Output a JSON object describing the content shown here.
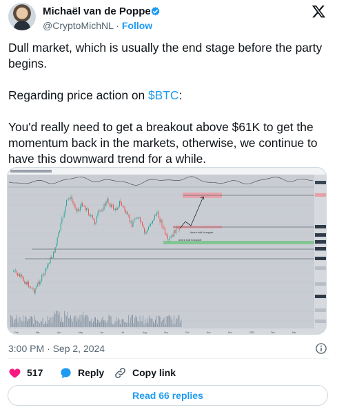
{
  "author": {
    "name": "Michaël van de Poppe",
    "handle": "@CryptoMichNL",
    "separator": " · ",
    "follow_label": "Follow"
  },
  "tweet": {
    "line1": "Dull market, which is usually the end stage before the party begins.",
    "line2_prefix": "Regarding price action on ",
    "cashtag": "$BTC",
    "line2_suffix": ":",
    "line3": "You'd really need to get a breakout above $61K to get the momentum back in the markets, otherwise, we continue to have this downward trend for a while."
  },
  "chart_image": {
    "annotations": [
      "Area to hold for support",
      "Area to hold for support"
    ],
    "x_ticks": [
      "Feb",
      "Mar",
      "Apr",
      "May",
      "Jun",
      "Jul",
      "Aug",
      "Sep",
      "Oct",
      "Nov",
      "Dec",
      "2025",
      "Feb",
      "Mar"
    ],
    "colors": {
      "up": "#26a69a",
      "down": "#ef5350",
      "resistance_zone": "#e8a0a8",
      "support_zone": "#7fc48f"
    }
  },
  "meta": {
    "timestamp": "3:00 PM · Sep 2, 2024"
  },
  "actions": {
    "likes": "517",
    "reply_label": "Reply",
    "copy_link_label": "Copy link"
  },
  "replies_button": "Read 66 replies",
  "colors": {
    "accent": "#1d9bf0",
    "like": "#f91880",
    "muted": "#536471"
  }
}
